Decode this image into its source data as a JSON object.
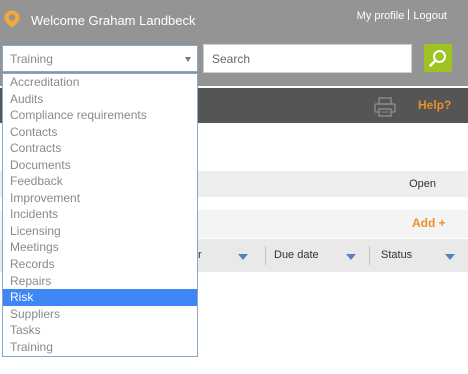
{
  "header": {
    "welcome": "Welcome Graham Landbeck",
    "my_profile": "My profile",
    "logout": "Logout",
    "logo_icon": "location-pin-icon"
  },
  "search": {
    "module_value": "Training",
    "placeholder": "Search",
    "button_icon": "search-icon"
  },
  "toolbar": {
    "print_icon": "printer-icon",
    "help": "Help?"
  },
  "content": {
    "status_value": "Open",
    "add_label": "Add +",
    "columns": [
      "r",
      "Due date",
      "Status"
    ]
  },
  "dropdown": {
    "items": [
      "Accreditation",
      "Audits",
      "Compliance requirements",
      "Contacts",
      "Contracts",
      "Documents",
      "Feedback",
      "Improvement",
      "Incidents",
      "Licensing",
      "Meetings",
      "Records",
      "Repairs",
      "Risk",
      "Suppliers",
      "Tasks",
      "Training"
    ],
    "highlighted": "Risk"
  },
  "colors": {
    "topbar": "#949494",
    "accent_green": "#9ec322",
    "accent_orange": "#e9902c",
    "highlight_blue": "#3e87f5"
  }
}
